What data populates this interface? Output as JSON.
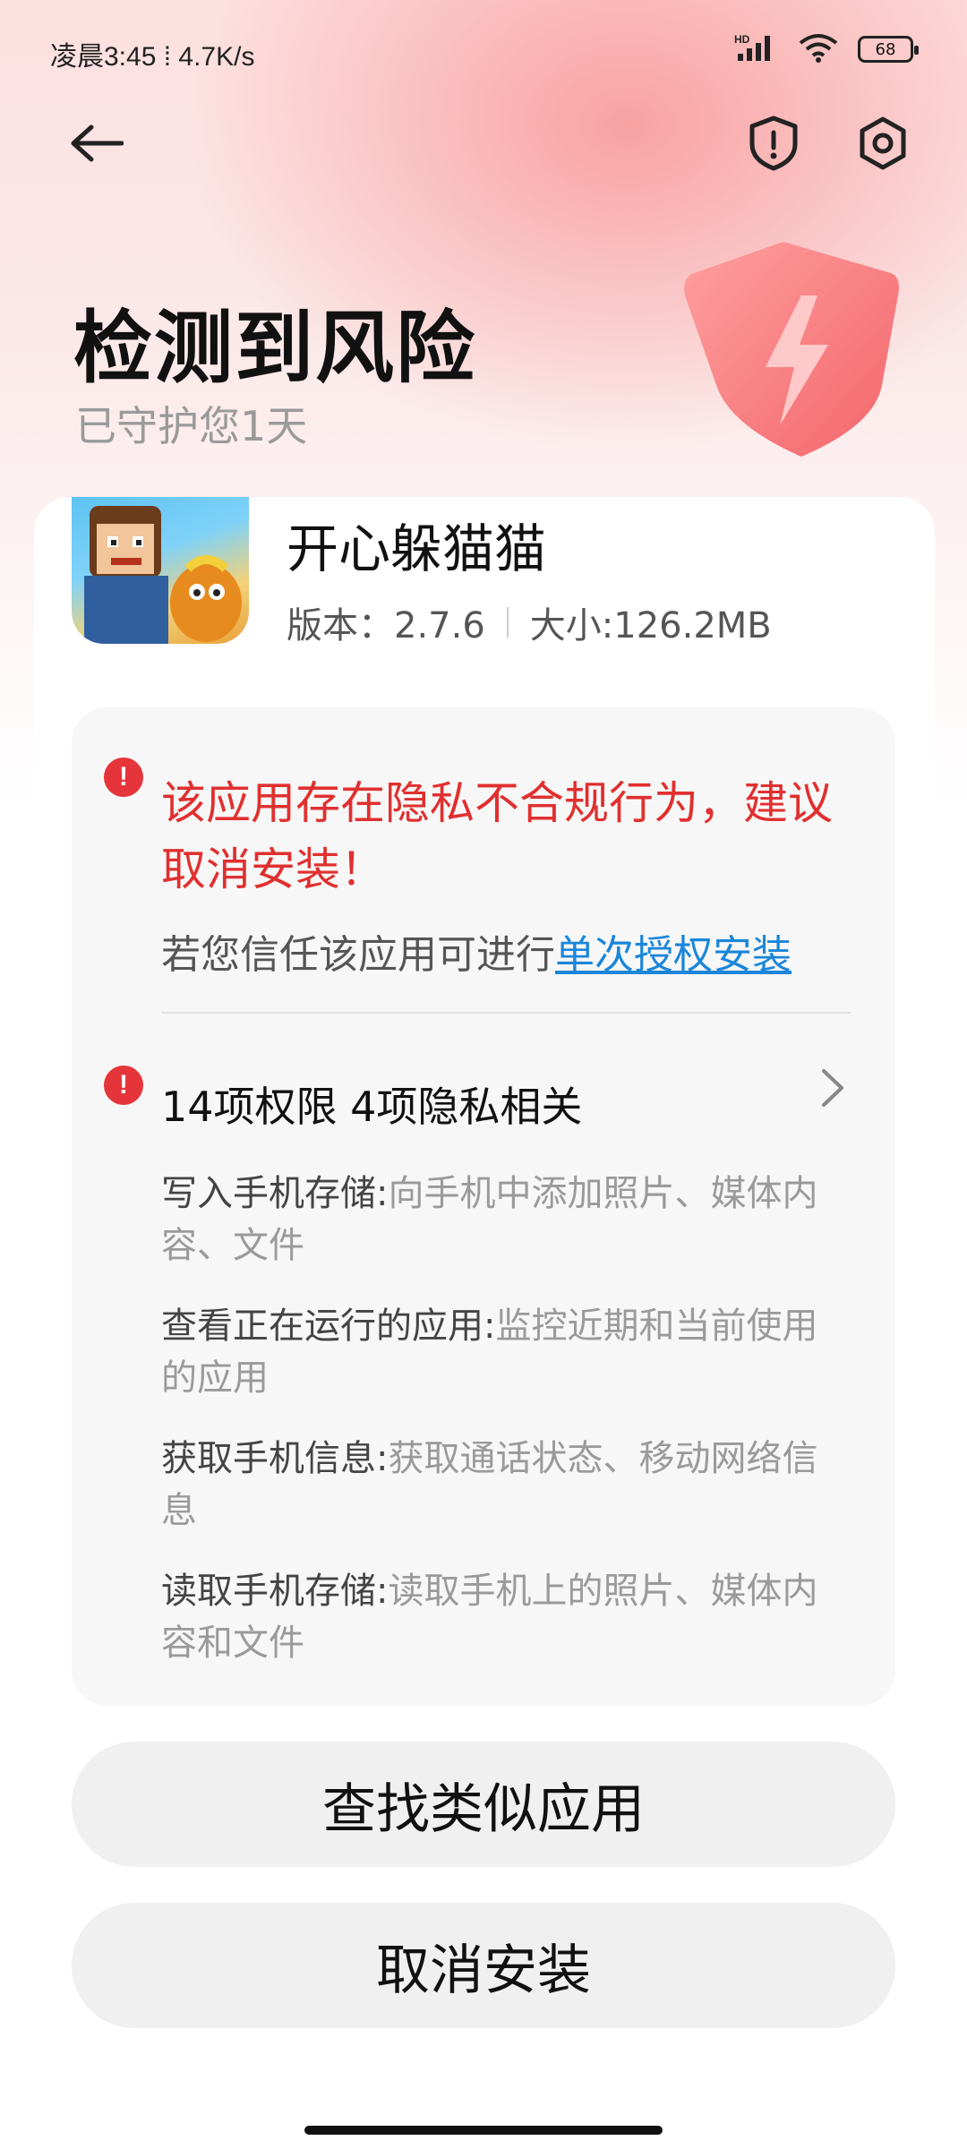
{
  "status_bar": {
    "time": "凌晨3:45 ⁞ 4.7K/s",
    "network_label": "HD",
    "battery": "68"
  },
  "header": {
    "title": "检测到风险",
    "subtitle": "已守护您1天"
  },
  "app": {
    "name": "开心躲猫猫",
    "version": "版本：2.7.6",
    "size": "大小:126.2MB"
  },
  "warning": {
    "message": "该应用存在隐私不合规行为，建议取消安装！",
    "trust_prefix": "若您信任该应用可进行",
    "trust_link": "单次授权安装"
  },
  "permissions": {
    "summary": "14项权限  4项隐私相关",
    "items": [
      {
        "name": "写入手机存储:",
        "desc": "向手机中添加照片、媒体内容、文件"
      },
      {
        "name": "查看正在运行的应用:",
        "desc": "监控近期和当前使用的应用"
      },
      {
        "name": "获取手机信息:",
        "desc": "获取通话状态、移动网络信息"
      },
      {
        "name": "读取手机存储:",
        "desc": "读取手机上的照片、媒体内容和文件"
      }
    ]
  },
  "buttons": {
    "find_similar": "查找类似应用",
    "cancel_install": "取消安装"
  },
  "colors": {
    "danger": "#e5353a",
    "link": "#1a86d9"
  }
}
